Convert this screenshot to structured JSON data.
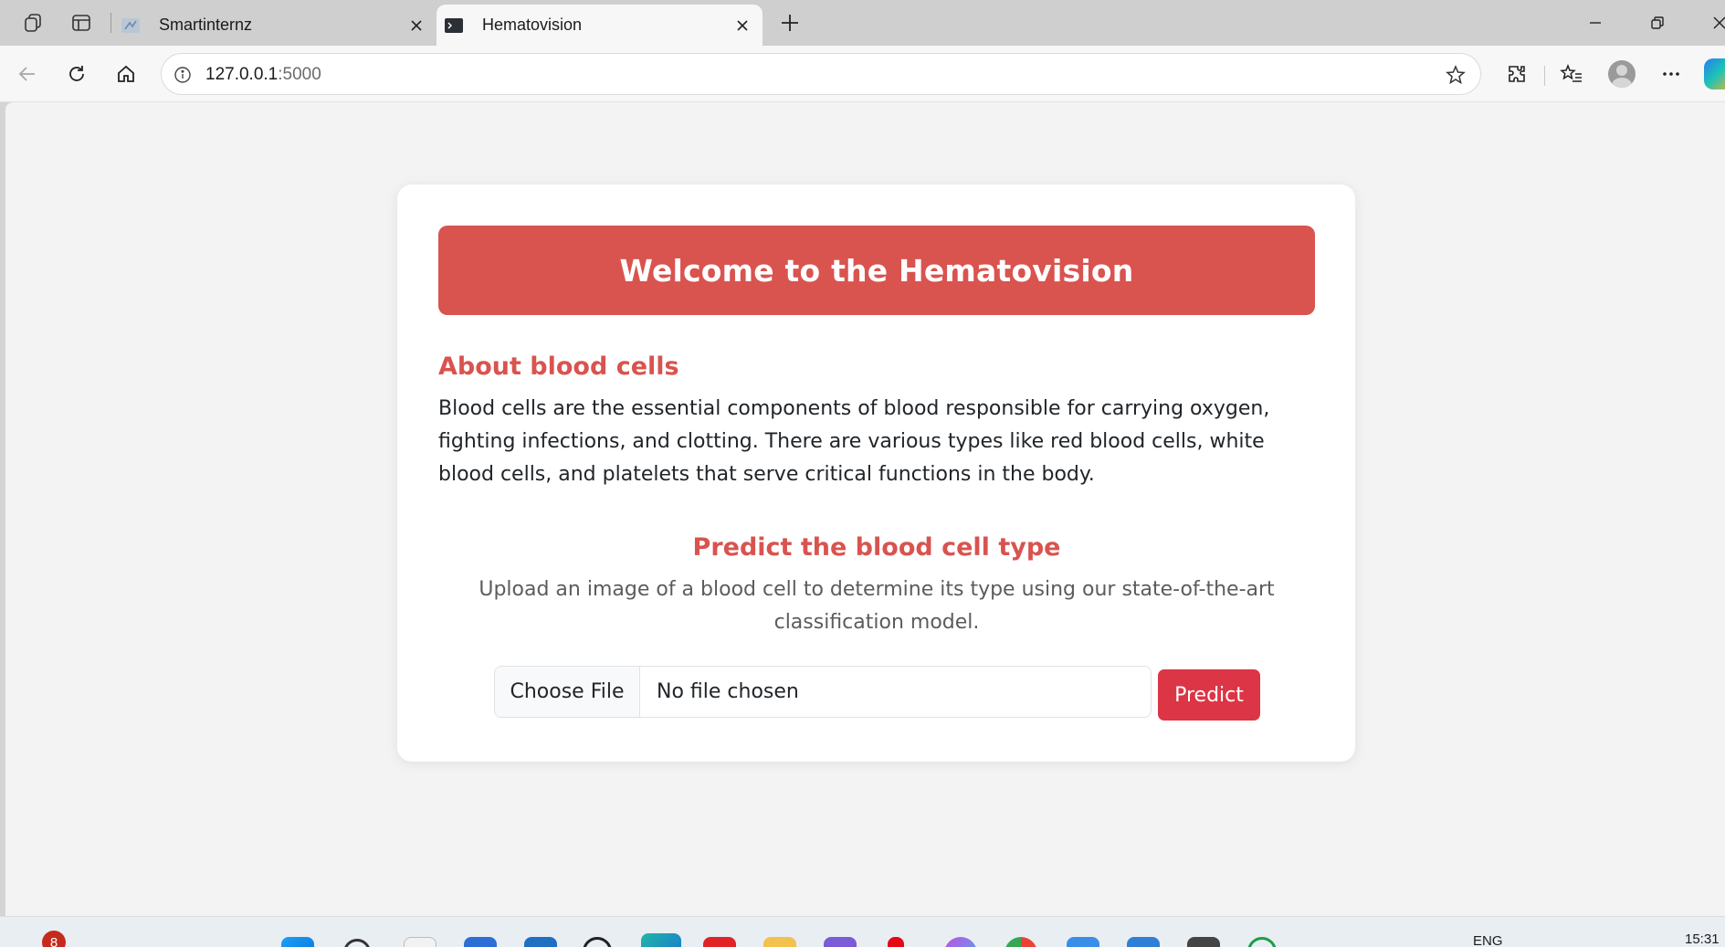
{
  "browser": {
    "tabs": [
      {
        "title": "Smartinternz",
        "active": false
      },
      {
        "title": "Hematovision",
        "active": true
      }
    ],
    "address": {
      "host": "127.0.0.1",
      "port": ":5000"
    }
  },
  "page": {
    "banner_title": "Welcome to the Hematovision",
    "about": {
      "title": "About blood cells",
      "text": "Blood cells are the essential components of blood responsible for carrying oxygen, fighting infections, and clotting. There are various types like red blood cells, white blood cells, and platelets that serve critical functions in the body."
    },
    "predict": {
      "title": "Predict the blood cell type",
      "text": "Upload an image of a blood cell to determine its type using our state-of-the-art classification model.",
      "choose_file_label": "Choose File",
      "file_status": "No file chosen",
      "button_label": "Predict"
    }
  },
  "taskbar": {
    "notification_count": "8",
    "language": "ENG",
    "time": "15:31"
  },
  "colors": {
    "accent": "#d9534f",
    "predict_button": "#dc3545",
    "page_background": "#f3f3f3"
  }
}
